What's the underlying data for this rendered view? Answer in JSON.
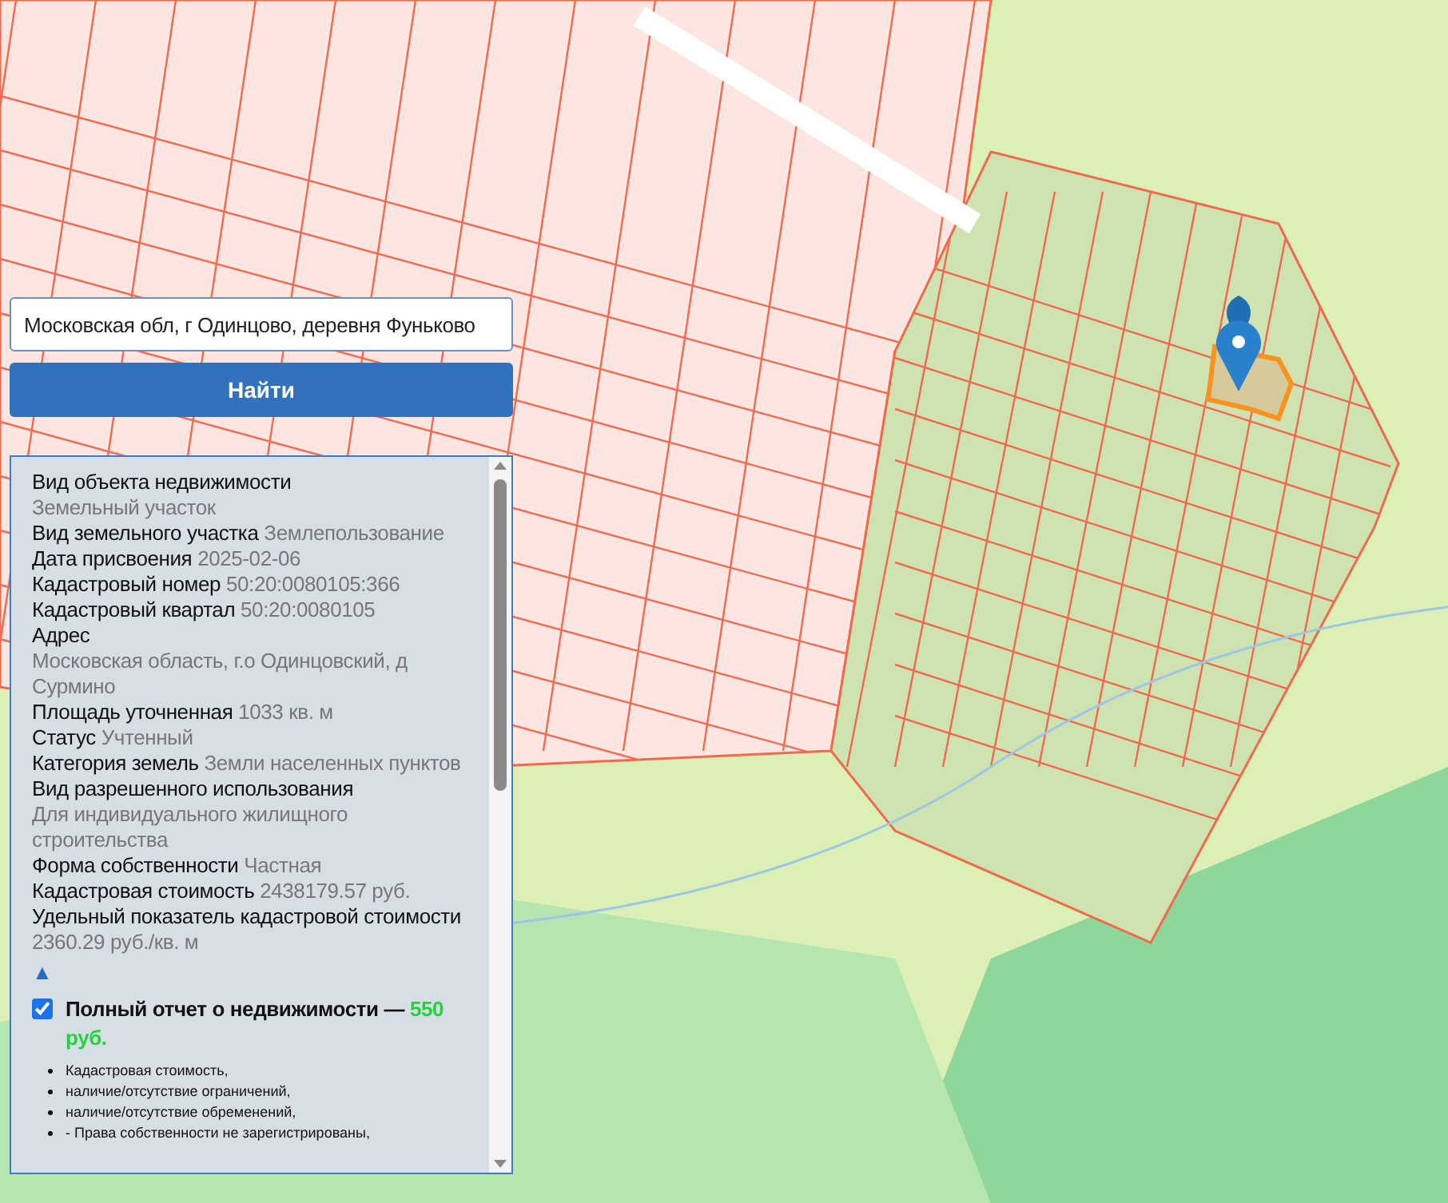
{
  "search": {
    "value": "Московская обл, г Одинцово, деревня Фуньково"
  },
  "search_button": {
    "label": "Найти"
  },
  "info": {
    "fields": [
      {
        "label": "Вид объекта недвижимости",
        "value": "Земельный участок"
      },
      {
        "label": "Вид земельного участка",
        "value": "Землепользование"
      },
      {
        "label": "Дата присвоения",
        "value": "2025-02-06"
      },
      {
        "label": "Кадастровый номер",
        "value": "50:20:0080105:366"
      },
      {
        "label": "Кадастровый квартал",
        "value": "50:20:0080105"
      },
      {
        "label": "Адрес",
        "value": "Московская область, г.о Одинцовский, д Сурмино"
      },
      {
        "label": "Площадь уточненная",
        "value": "1033 кв. м"
      },
      {
        "label": "Статус",
        "value": "Учтенный"
      },
      {
        "label": "Категория земель",
        "value": "Земли населенных пунктов"
      },
      {
        "label": "Вид разрешенного использования",
        "value": "Для индивидуального жилищного строительства"
      },
      {
        "label": "Форма собственности",
        "value": "Частная"
      },
      {
        "label": "Кадастровая стоимость",
        "value": "2438179.57 руб."
      },
      {
        "label": "Удельный показатель кадастровой стоимости",
        "value": "2360.29 руб./кв. м"
      }
    ],
    "collapse_toggle": "▲"
  },
  "report": {
    "checked": true,
    "title": "Полный отчет о недвижимости —",
    "price": "550 руб.",
    "items": [
      "Кадастровая стоимость,",
      "наличие/отсутствие ограничений,",
      "наличие/отсутствие обременений,",
      "- Права собственности не зарегистрированы,"
    ]
  }
}
